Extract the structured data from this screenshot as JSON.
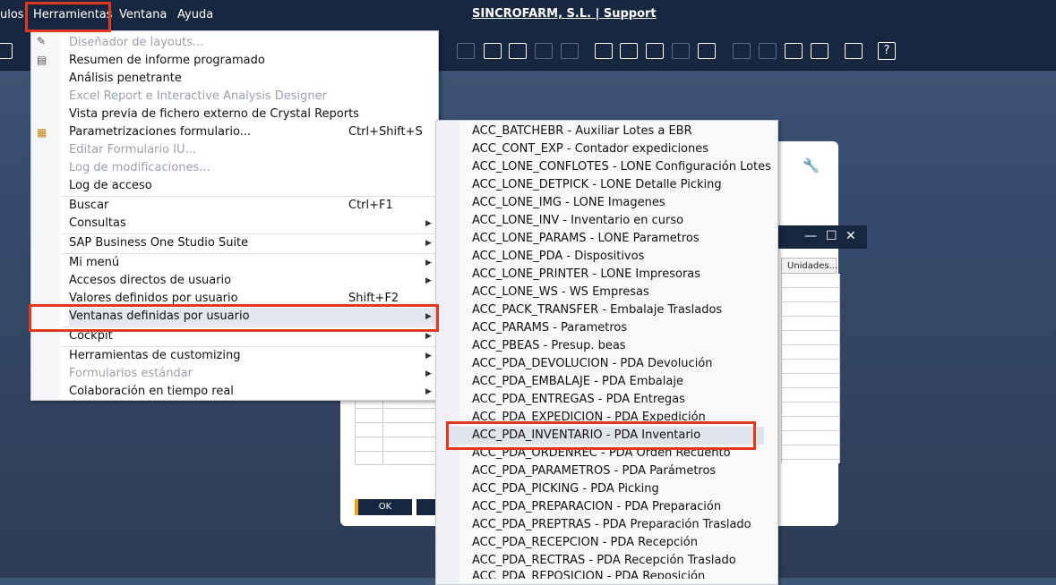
{
  "menubar": {
    "items": [
      "ulos",
      "Herramientas",
      "Ventana",
      "Ayuda"
    ],
    "company": "SINCROFARM, S.L. | Support"
  },
  "toolbar": {
    "help_label": "?"
  },
  "background_window": {
    "column_header": "Unidades...",
    "ok_label": "OK",
    "controls": {
      "minimize": "—",
      "maximize": "☐",
      "close": "✕"
    }
  },
  "menu": {
    "items": [
      {
        "label": "Diseñador de layouts...",
        "shortcut": "",
        "enabled": false
      },
      {
        "label": "Resumen de informe programado",
        "shortcut": "",
        "enabled": true
      },
      {
        "label": "Análisis penetrante",
        "shortcut": "",
        "enabled": true
      },
      {
        "label": "Excel Report e Interactive Analysis Designer",
        "shortcut": "",
        "enabled": false
      },
      {
        "label": "Vista previa de fichero externo de Crystal Reports",
        "shortcut": "",
        "enabled": true
      },
      {
        "label": "Parametrizaciones formulario...",
        "shortcut": "Ctrl+Shift+S",
        "enabled": true
      },
      {
        "label": "Editar Formulario IU...",
        "shortcut": "",
        "enabled": false
      },
      {
        "label": "Log de modificaciones...",
        "shortcut": "",
        "enabled": false
      },
      {
        "label": "Log de acceso",
        "shortcut": "",
        "enabled": true
      },
      {
        "label": "Buscar",
        "shortcut": "Ctrl+F1",
        "enabled": true
      },
      {
        "label": "Consultas",
        "shortcut": "",
        "enabled": true
      },
      {
        "label": "SAP Business One Studio Suite",
        "shortcut": "",
        "enabled": true
      },
      {
        "label": "Mi menú",
        "shortcut": "",
        "enabled": true
      },
      {
        "label": "Accesos directos de usuario",
        "shortcut": "",
        "enabled": true
      },
      {
        "label": "Valores definidos por usuario",
        "shortcut": "Shift+F2",
        "enabled": true
      },
      {
        "label": "Ventanas definidas por usuario",
        "shortcut": "",
        "enabled": true
      },
      {
        "label": "Cockpit",
        "shortcut": "",
        "enabled": true
      },
      {
        "label": "Herramientas de customizing",
        "shortcut": "",
        "enabled": true
      },
      {
        "label": "Formularios estándar",
        "shortcut": "",
        "enabled": false
      },
      {
        "label": "Colaboración en tiempo real",
        "shortcut": "",
        "enabled": true
      }
    ]
  },
  "submenu": {
    "items": [
      "ACC_BATCHEBR - Auxiliar Lotes a EBR",
      "ACC_CONT_EXP - Contador expediciones",
      "ACC_LONE_CONFLOTES - LONE Configuración Lotes",
      "ACC_LONE_DETPICK - LONE Detalle Picking",
      "ACC_LONE_IMG - LONE Imagenes",
      "ACC_LONE_INV - Inventario en curso",
      "ACC_LONE_PARAMS - LONE Parametros",
      "ACC_LONE_PDA - Dispositivos",
      "ACC_LONE_PRINTER - LONE Impresoras",
      "ACC_LONE_WS - WS Empresas",
      "ACC_PACK_TRANSFER - Embalaje Traslados",
      "ACC_PARAMS - Parametros",
      "ACC_PBEAS - Presup. beas",
      "ACC_PDA_DEVOLUCION - PDA Devolución",
      "ACC_PDA_EMBALAJE - PDA Embalaje",
      "ACC_PDA_ENTREGAS - PDA Entregas",
      "ACC_PDA_EXPEDICION - PDA Expedición",
      "ACC_PDA_INVENTARIO - PDA Inventario",
      "ACC_PDA_ORDENREC - PDA Orden Recuento",
      "ACC_PDA_PARAMETROS - PDA Parámetros",
      "ACC_PDA_PICKING - PDA Picking",
      "ACC_PDA_PREPARACION - PDA Preparación",
      "ACC_PDA_PREPTRAS - PDA Preparación Traslado",
      "ACC_PDA_RECEPCION - PDA Recepción",
      "ACC_PDA_RECTRAS - PDA Recepción Traslado",
      "ACC_PDA_REPOSICION - PDA Reposición"
    ]
  },
  "colors": {
    "highlight_box": "#e03a1e",
    "menubar_bg": "#17273f"
  }
}
